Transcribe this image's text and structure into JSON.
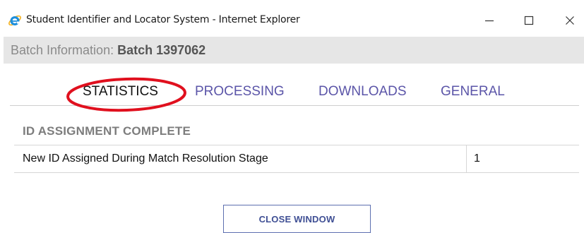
{
  "window": {
    "title": "Student Identifier and Locator System - Internet Explorer",
    "icon": "internet-explorer-icon",
    "controls": [
      "minimize-icon",
      "maximize-icon",
      "close-icon"
    ]
  },
  "batch": {
    "label": "Batch Information: ",
    "value": "Batch 1397062"
  },
  "tabs": [
    {
      "label": "STATISTICS",
      "active": true
    },
    {
      "label": "PROCESSING",
      "active": false
    },
    {
      "label": "DOWNLOADS",
      "active": false
    },
    {
      "label": "GENERAL",
      "active": false
    }
  ],
  "section": {
    "title": "ID ASSIGNMENT COMPLETE",
    "rows": [
      {
        "label": "New ID Assigned During Match Resolution Stage",
        "value": "1"
      }
    ]
  },
  "close_button": "CLOSE WINDOW",
  "colors": {
    "tab_inactive": "#5b55a8",
    "highlight_ring": "#e0101e",
    "batch_bar": "#e6e6e6"
  }
}
